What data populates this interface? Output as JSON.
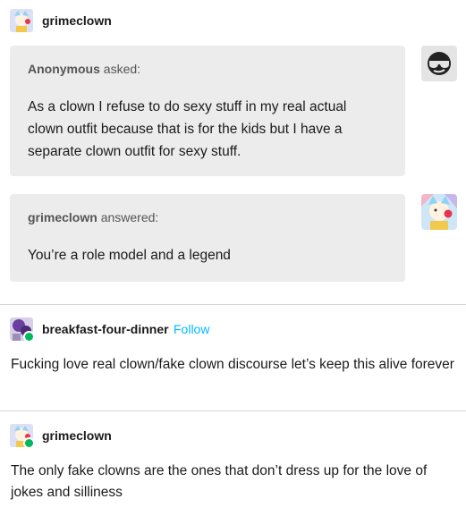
{
  "post": {
    "author": "grimeclown",
    "ask": {
      "asker": "Anonymous",
      "verb": "asked:",
      "text": "As a clown I refuse to do sexy stuff in my real actual clown outfit because that is for the kids but I have a separate clown outfit for sexy stuff."
    },
    "answer": {
      "answerer": "grimeclown",
      "verb": "answered:",
      "text": "You’re a role model and a legend"
    }
  },
  "reblogs": [
    {
      "author": "breakfast-four-dinner",
      "follow_label": "Follow",
      "text": "Fucking love real clown/fake clown discourse let’s keep this alive forever"
    },
    {
      "author": "grimeclown",
      "text": "The only fake clowns are the ones that don’t dress up for the love of jokes and silliness"
    }
  ],
  "colors": {
    "follow": "#00b8ff",
    "bubble": "#ececec",
    "reblog_badge": "#00b85c"
  }
}
